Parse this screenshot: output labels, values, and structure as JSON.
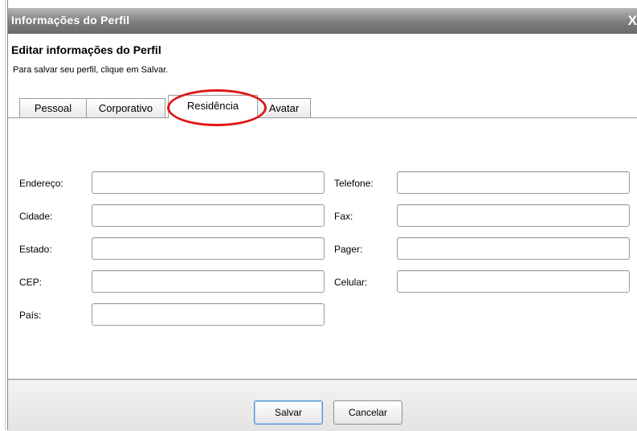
{
  "window": {
    "title": "Informações do Perfil",
    "close_glyph": "X"
  },
  "header": {
    "heading": "Editar informações do Perfil",
    "instructions": "Para salvar seu perfil, clique em Salvar."
  },
  "tabs": [
    {
      "label": "Pessoal",
      "active": false
    },
    {
      "label": "Corporativo",
      "active": false
    },
    {
      "label": "Residência",
      "active": true
    },
    {
      "label": "Avatar",
      "active": false
    }
  ],
  "fields": {
    "left": [
      {
        "label": "Endereço:",
        "value": ""
      },
      {
        "label": "Cidade:",
        "value": ""
      },
      {
        "label": "Estado:",
        "value": ""
      },
      {
        "label": "CEP:",
        "value": ""
      },
      {
        "label": "País:",
        "value": ""
      }
    ],
    "right": [
      {
        "label": "Telefone:",
        "value": ""
      },
      {
        "label": "Fax:",
        "value": ""
      },
      {
        "label": "Pager:",
        "value": ""
      },
      {
        "label": "Celular:",
        "value": ""
      }
    ]
  },
  "buttons": {
    "save": "Salvar",
    "cancel": "Cancelar"
  },
  "annotation": {
    "color": "#e01717",
    "target": "Residência"
  },
  "colors": {
    "titlebar": "#7d7d7d",
    "focus_border": "#4f8fd0"
  }
}
